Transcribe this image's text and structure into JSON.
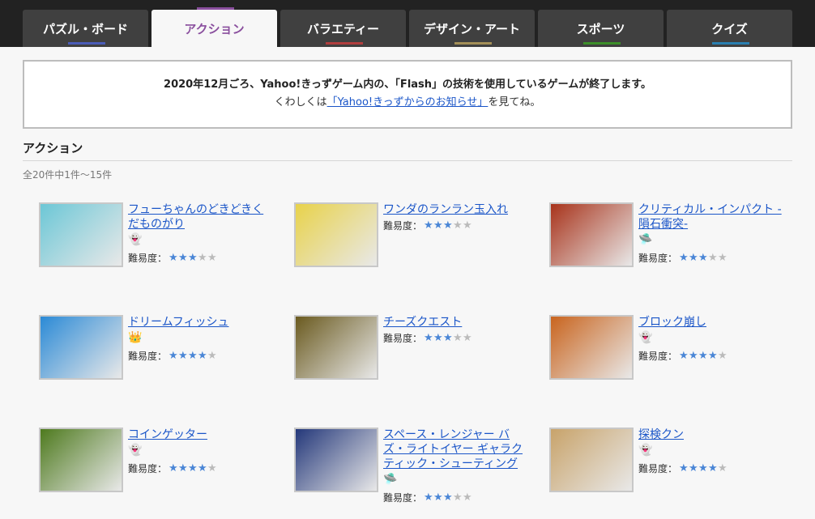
{
  "tabs": [
    {
      "label": "パズル・ボード",
      "color": "#4a5cb7"
    },
    {
      "label": "アクション",
      "color": "#8a4f9e",
      "active": true
    },
    {
      "label": "バラエティー",
      "color": "#b03e3e"
    },
    {
      "label": "デザイン・アート",
      "color": "#a38f57"
    },
    {
      "label": "スポーツ",
      "color": "#3d8f2a"
    },
    {
      "label": "クイズ",
      "color": "#2a7fb0"
    }
  ],
  "notice": {
    "line1": "2020年12月ごろ、Yahoo!きっずゲーム内の、「Flash」の技術を使用しているゲームが終了します。",
    "line2_prefix": "くわしくは",
    "link": "「Yahoo!きっずからのお知らせ」",
    "line2_suffix": "を見てね。"
  },
  "section": {
    "title": "アクション",
    "count": "全20件中1件～15件"
  },
  "difficulty_label": "難易度：",
  "games": [
    {
      "title": "フューちゃんのどきどきくだものがり",
      "badge": "ghost",
      "stars": 3,
      "thumb_color": "#6cc7d6"
    },
    {
      "title": "ワンダのランラン玉入れ",
      "badge": "",
      "stars": 3,
      "thumb_color": "#e8d24a"
    },
    {
      "title": "クリティカル・インパクト -隕石衝突-",
      "badge": "ufo",
      "stars": 3,
      "thumb_color": "#a8331b"
    },
    {
      "title": "ドリームフィッシュ",
      "badge": "crown",
      "stars": 4,
      "thumb_color": "#2b8ad6"
    },
    {
      "title": "チーズクエスト",
      "badge": "",
      "stars": 3,
      "thumb_color": "#6a5a1f"
    },
    {
      "title": "ブロック崩し",
      "badge": "ghost",
      "stars": 4,
      "thumb_color": "#c9641e"
    },
    {
      "title": "コインゲッター",
      "badge": "ghost",
      "stars": 4,
      "thumb_color": "#4e7a1e"
    },
    {
      "title": "スペース・レンジャー バズ・ライトイヤー ギャラクティック・シューティング",
      "badge": "ufo",
      "stars": 3,
      "thumb_color": "#24387a"
    },
    {
      "title": "探検クン",
      "badge": "ghost",
      "stars": 4,
      "thumb_color": "#c8a36a"
    }
  ]
}
